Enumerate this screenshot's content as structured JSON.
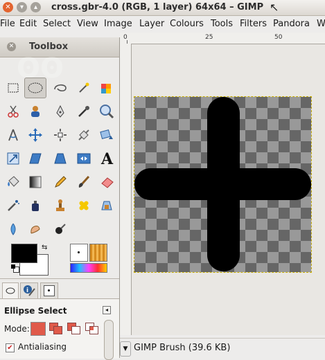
{
  "window": {
    "title": "cross.gbr-4.0 (RGB, 1 layer) 64x64 – GIMP"
  },
  "menubar": {
    "items": [
      "File",
      "Edit",
      "Select",
      "View",
      "Image",
      "Layer",
      "Colours",
      "Tools",
      "Filters",
      "Pandora",
      "W"
    ]
  },
  "ruler": {
    "ticks": [
      "0",
      "25",
      "50"
    ]
  },
  "toolbox": {
    "title": "Toolbox"
  },
  "tool_options": {
    "title": "Ellipse Select",
    "mode_label": "Mode:",
    "antialiasing_label": "Antialiasing",
    "antialiasing_checked": true
  },
  "statusbar": {
    "text": "GIMP Brush (39.6 KB)"
  },
  "colors": {
    "foreground": "#000000",
    "background": "#ffffff",
    "selection_border": "#c9b000"
  }
}
